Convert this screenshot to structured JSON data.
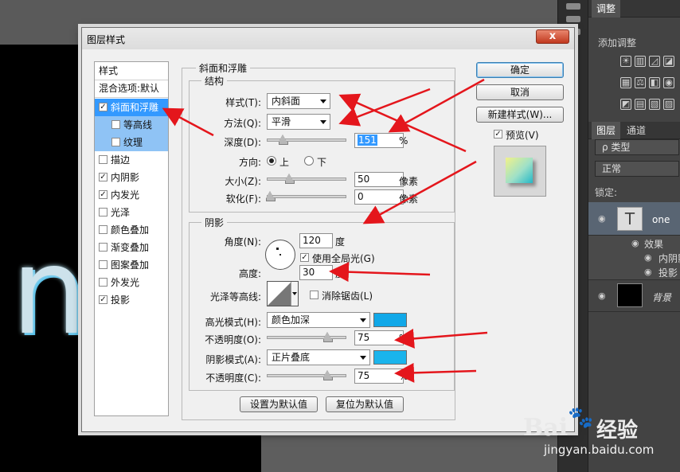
{
  "dialog": {
    "title": "图层样式",
    "close_label": "x",
    "style_list": {
      "header": "样式",
      "blend_options": "混合选项:默认",
      "items": [
        {
          "label": "斜面和浮雕",
          "checked": true
        },
        {
          "label": "等高线",
          "checked": false
        },
        {
          "label": "纹理",
          "checked": false
        },
        {
          "label": "描边",
          "checked": false
        },
        {
          "label": "内阴影",
          "checked": true
        },
        {
          "label": "内发光",
          "checked": true
        },
        {
          "label": "光泽",
          "checked": false
        },
        {
          "label": "颜色叠加",
          "checked": false
        },
        {
          "label": "渐变叠加",
          "checked": false
        },
        {
          "label": "图案叠加",
          "checked": false
        },
        {
          "label": "外发光",
          "checked": false
        },
        {
          "label": "投影",
          "checked": true
        }
      ]
    },
    "bevel": {
      "title": "斜面和浮雕",
      "structure": {
        "title": "结构",
        "style_label": "样式(T):",
        "style_value": "内斜面",
        "technique_label": "方法(Q):",
        "technique_value": "平滑",
        "depth_label": "深度(D):",
        "depth_value": "151",
        "depth_unit": "%",
        "direction_label": "方向:",
        "direction_up": "上",
        "direction_down": "下",
        "size_label": "大小(Z):",
        "size_value": "50",
        "size_unit": "像素",
        "soften_label": "软化(F):",
        "soften_value": "0",
        "soften_unit": "像素"
      },
      "shading": {
        "title": "阴影",
        "angle_label": "角度(N):",
        "angle_value": "120",
        "angle_unit": "度",
        "global_light_label": "使用全局光(G)",
        "altitude_label": "高度:",
        "altitude_value": "30",
        "altitude_unit": "度",
        "gloss_contour_label": "光泽等高线:",
        "anti_alias_label": "消除锯齿(L)",
        "highlight_mode_label": "高光模式(H):",
        "highlight_mode_value": "颜色加深",
        "highlight_opacity_label": "不透明度(O):",
        "highlight_opacity_value": "75",
        "shadow_mode_label": "阴影模式(A):",
        "shadow_mode_value": "正片叠底",
        "shadow_opacity_label": "不透明度(C):",
        "shadow_opacity_value": "75",
        "percent": "%",
        "highlight_color": "#11a8e8",
        "shadow_color": "#1ab4ec"
      },
      "make_default": "设置为默认值",
      "reset_default": "复位为默认值"
    },
    "buttons": {
      "ok": "确定",
      "cancel": "取消",
      "new_style": "新建样式(W)...",
      "preview": "预览(V)"
    }
  },
  "panels": {
    "adjust_tab": "调整",
    "add_adjust": "添加调整",
    "layers_tab": "图层",
    "channels_tab": "通道",
    "kind_filter": "ρ 类型",
    "blend_mode": "正常",
    "lock_label": "锁定:",
    "layers": [
      {
        "name": "one"
      },
      {
        "name": "背景"
      }
    ],
    "effects_label": "效果",
    "effect_items": [
      "内阴影",
      "投影"
    ]
  },
  "canvas": {
    "text": "n"
  },
  "watermark": {
    "logo": "Bai",
    "brand": "经验",
    "url": "jingyan.baidu.com"
  }
}
